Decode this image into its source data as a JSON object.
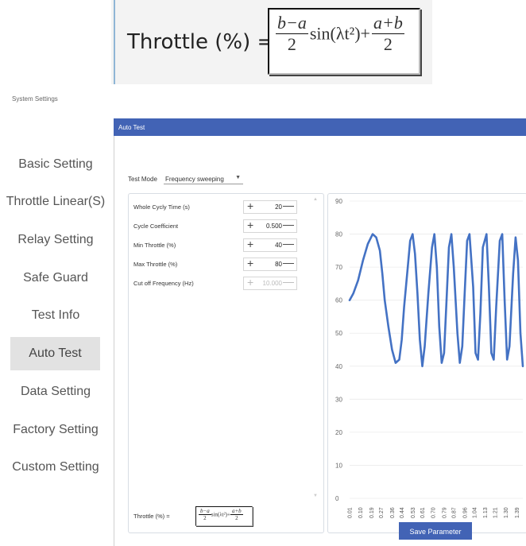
{
  "banner": {
    "label": "Throttle (%) =",
    "formula": {
      "frac1_num": "b−a",
      "frac1_den": "2",
      "sin_part": "sin(λt²)+",
      "frac2_num": "a+b",
      "frac2_den": "2"
    }
  },
  "window": {
    "title": "System Settings"
  },
  "nav": {
    "items": [
      {
        "label": "Basic Setting"
      },
      {
        "label": "Throttle Linear(S)"
      },
      {
        "label": "Relay Setting"
      },
      {
        "label": "Safe Guard"
      },
      {
        "label": "Test Info"
      },
      {
        "label": "Auto Test",
        "active": true
      },
      {
        "label": "Data Setting"
      },
      {
        "label": "Factory Setting"
      },
      {
        "label": "Custom Setting"
      }
    ]
  },
  "panel": {
    "title": "Auto Test",
    "test_mode_label": "Test Mode",
    "test_mode_value": "Frequency sweeping",
    "params": [
      {
        "label": "Whole Cycly Time (s)",
        "value": "20",
        "disabled": false
      },
      {
        "label": "Cycle Coefficient",
        "value": "0.500",
        "disabled": false
      },
      {
        "label": "Min Throttle (%)",
        "value": "40",
        "disabled": false
      },
      {
        "label": "Max Throttle (%)",
        "value": "80",
        "disabled": false
      },
      {
        "label": "Cut off Frequency (Hz)",
        "value": "10.000",
        "disabled": true
      }
    ],
    "formula_label": "Throttle (%) =",
    "save_label": "Save Parameter"
  },
  "colors": {
    "accent": "#4263b5",
    "line": "#4472c4"
  },
  "chart_data": {
    "type": "line",
    "y_ticks": [
      "0",
      "10",
      "20",
      "30",
      "40",
      "50",
      "60",
      "70",
      "80",
      "90"
    ],
    "ylim": [
      0,
      90
    ],
    "x_ticks": [
      "0.01",
      "0.10",
      "0.19",
      "0.27",
      "0.36",
      "0.44",
      "0.53",
      "0.61",
      "0.70",
      "0.79",
      "0.87",
      "0.96",
      "1.04",
      "1.13",
      "1.21",
      "1.30",
      "1.39"
    ],
    "series": [
      {
        "min": 40,
        "max": 80,
        "x": [
          0.01,
          0.04,
          0.08,
          0.12,
          0.16,
          0.2,
          0.23,
          0.26,
          0.28,
          0.3,
          0.33,
          0.36,
          0.39,
          0.42,
          0.44,
          0.46,
          0.49,
          0.51,
          0.53,
          0.55,
          0.57,
          0.59,
          0.61,
          0.63,
          0.66,
          0.69,
          0.71,
          0.73,
          0.75,
          0.77,
          0.79,
          0.81,
          0.83,
          0.85,
          0.87,
          0.9,
          0.92,
          0.94,
          0.96,
          0.98,
          1.0,
          1.03,
          1.05,
          1.07,
          1.09,
          1.11,
          1.14,
          1.16,
          1.18,
          1.2,
          1.22,
          1.25,
          1.27,
          1.29,
          1.31,
          1.33,
          1.36,
          1.38,
          1.4,
          1.42,
          1.44
        ],
        "values": [
          60,
          62,
          66,
          72,
          77,
          80,
          79,
          75,
          68,
          60,
          52,
          45,
          41,
          42,
          48,
          58,
          70,
          78,
          80,
          74,
          62,
          48,
          40,
          46,
          62,
          76,
          80,
          70,
          52,
          41,
          44,
          60,
          76,
          80,
          70,
          50,
          41,
          46,
          62,
          78,
          80,
          64,
          44,
          42,
          56,
          76,
          80,
          64,
          44,
          42,
          58,
          78,
          80,
          60,
          42,
          46,
          68,
          79,
          72,
          50,
          40
        ]
      }
    ]
  }
}
